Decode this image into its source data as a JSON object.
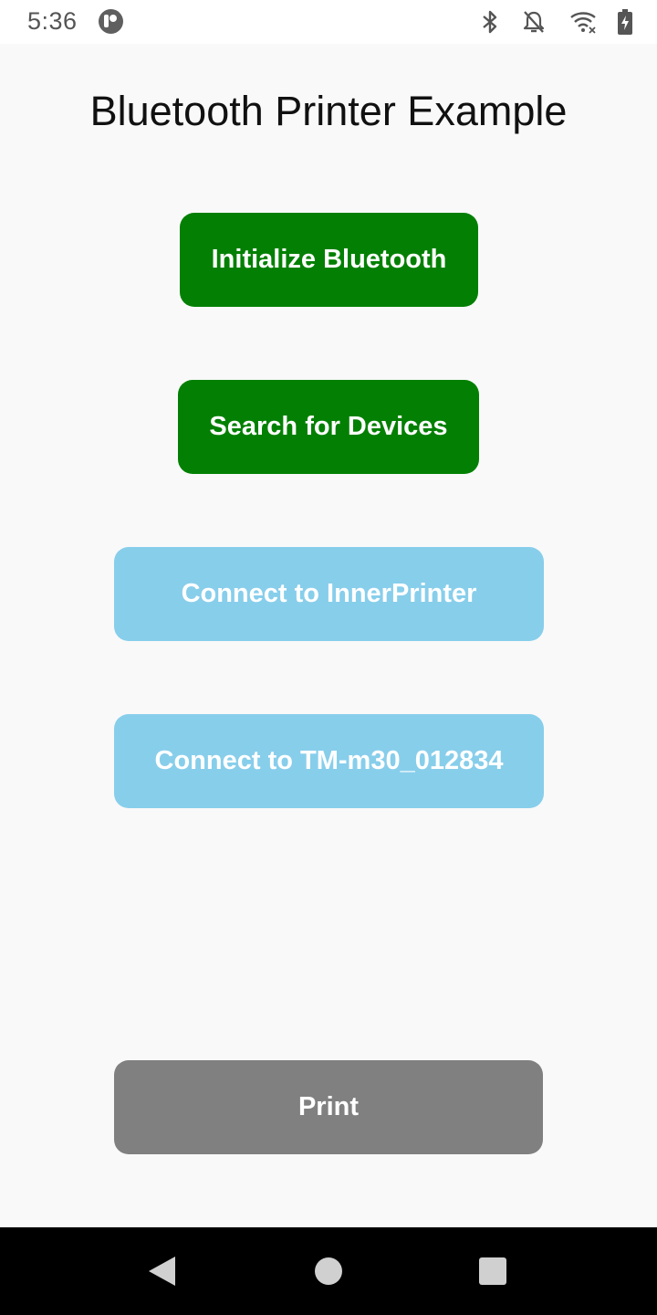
{
  "status_bar": {
    "time": "5:36",
    "icons": [
      "app-badge-icon",
      "bluetooth-icon",
      "notifications-off-icon",
      "wifi-icon",
      "battery-charging-icon"
    ]
  },
  "title": "Bluetooth Printer Example",
  "buttons": {
    "initialize": "Initialize Bluetooth",
    "search": "Search for Devices",
    "connect_inner": "Connect to InnerPrinter",
    "connect_tm": "Connect to TM-m30_012834",
    "print": "Print"
  },
  "colors": {
    "primary_enabled": "#038003",
    "connect_buttons": "#87ceeb",
    "disabled": "#808080",
    "background": "#f9f9f9"
  },
  "nav_bar": {
    "icons": [
      "back-icon",
      "home-icon",
      "recents-icon"
    ]
  }
}
